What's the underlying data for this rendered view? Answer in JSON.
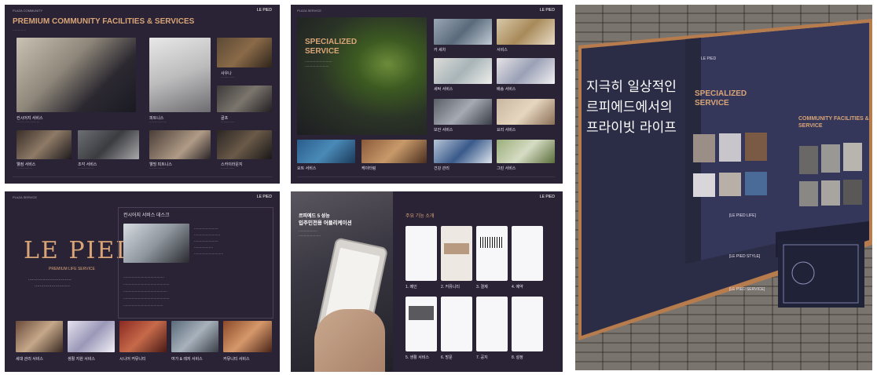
{
  "colors": {
    "panel_bg": "#2a2336",
    "accent": "#d9a577",
    "wall_panel": "#2b2c45",
    "frame": "#b67c4e"
  },
  "panel1": {
    "small_header": "PLAZA COMMUNITY",
    "title": "PREMIUM COMMUNITY FACILITIES & SERVICES",
    "logo": "LE PIED",
    "captions": [
      "컨시어지 서비스",
      "피트니스",
      "사우나",
      "골프",
      "사이클",
      "웰컴 서비스",
      "조각 서비스",
      "웰빙 피트니스",
      "스카이라운지"
    ]
  },
  "panel2": {
    "small_header": "PLAZA SERVICE",
    "title_line1": "SPECIALIZED",
    "title_line2": "SERVICE",
    "logo": "LE PIED",
    "captions": [
      "카 세차",
      "서비스",
      "세탁 서비스",
      "배송 서비스",
      "보안 서비스",
      "요리 서비스",
      "요트 서비스",
      "케이터링",
      "건강 관리",
      "그린 서비스"
    ]
  },
  "panel3": {
    "small_header": "PLAZA SERVICE",
    "brand": "LE PIED",
    "brand_sub": "PREMIUM LIFE SERVICE",
    "section_title": "컨시어지 서비스 데스크",
    "photos": [
      "세대 관리 서비스",
      "생활 지원 서비스",
      "시니어 커뮤니티",
      "여가 & 레저 서비스",
      "커뮤니티 서비스"
    ],
    "logo": "LE PIED"
  },
  "panel4": {
    "small_header": "PLAZA APPLICATION",
    "headline_line1": "르피에드 5 성능",
    "headline_line2": "입주민전용 어플리케이션",
    "section_title": "주요 기능 소개",
    "logo": "LE PIED",
    "steps": [
      "1. 메인",
      "2. 커뮤니티",
      "3. 결제",
      "4. 예약",
      "5. 생활 서비스",
      "6. 방문",
      "7. 공지",
      "8. 설정"
    ]
  },
  "panel5": {
    "korean_line1": "지극히 일상적인",
    "korean_line2": "르피에드에서의",
    "korean_line3": "프라이빗 라이프",
    "title_line1": "SPECIALIZED",
    "title_line2": "SERVICE",
    "right_title_line1": "COMMUNITY FACILITIES &",
    "right_title_line2": "SERVICE",
    "section_labels": [
      "[LE PIED LIFE]",
      "[LE PIED STYLE]",
      "[LE PIED SERVICE]"
    ],
    "logo": "LE PIED"
  }
}
